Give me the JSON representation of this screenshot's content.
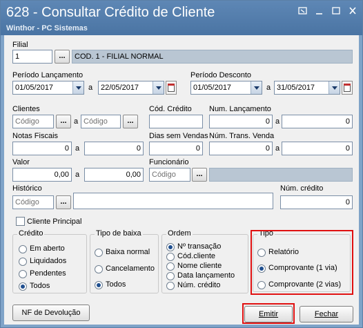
{
  "window": {
    "title": "628 - Consultar Crédito de Cliente",
    "subtitle": "Winthor - PC Sistemas",
    "controls": [
      "restore",
      "minimize",
      "maximize",
      "close"
    ]
  },
  "filial": {
    "label": "Filial",
    "code": "1",
    "description": "COD. 1 - FILIAL NORMAL"
  },
  "periodo_lancamento": {
    "label": "Período Lançamento",
    "start": "01/05/2017",
    "sep": "a",
    "end": "22/05/2017"
  },
  "periodo_desconto": {
    "label": "Período Desconto",
    "start": "01/05/2017",
    "sep": "a",
    "end": "31/05/2017"
  },
  "clientes": {
    "label": "Clientes",
    "from_placeholder": "Código",
    "sep": "a",
    "to_placeholder": "Código"
  },
  "cod_credito": {
    "label": "Cód. Crédito",
    "value": ""
  },
  "num_lancamento": {
    "label": "Num. Lançamento",
    "from": "0",
    "sep": "a",
    "to": "0"
  },
  "notas_fiscais": {
    "label": "Notas Fiscais",
    "from": "0",
    "sep": "a",
    "to": "0"
  },
  "dias_sem_vendas": {
    "label": "Dias sem Vendas",
    "value": "0"
  },
  "num_trans_venda": {
    "label": "Núm. Trans. Venda",
    "from": "0",
    "sep": "a",
    "to": "0"
  },
  "valor": {
    "label": "Valor",
    "from": "0,00",
    "sep": "a",
    "to": "0,00"
  },
  "funcionario": {
    "label": "Funcionário",
    "placeholder": "Código"
  },
  "historico": {
    "label": "Histórico",
    "placeholder": "Código"
  },
  "num_credito": {
    "label": "Núm. crédito",
    "value": "0"
  },
  "cliente_principal": {
    "label": "Cliente Principal",
    "checked": false
  },
  "credito": {
    "title": "Crédito",
    "options": [
      "Em aberto",
      "Liquidados",
      "Pendentes",
      "Todos"
    ],
    "selected": "Todos"
  },
  "tipo_baixa": {
    "title": "Tipo de baixa",
    "options": [
      "Baixa normal",
      "Cancelamento",
      "Todos"
    ],
    "selected": "Todos"
  },
  "ordem": {
    "title": "Ordem",
    "options": [
      "Nº transação",
      "Cód.cliente",
      "Nome cliente",
      "Data lançamento",
      "Núm. crédito"
    ],
    "selected": "Nº transação"
  },
  "tipo": {
    "title": "Tipo",
    "options": [
      "Relatório",
      "Comprovante (1 via)",
      "Comprovante (2 vias)"
    ],
    "selected": "Comprovante (1 via)"
  },
  "buttons": {
    "nf_devolucao": "NF de Devolução",
    "emitir": "Emitir",
    "fechar": "Fechar"
  },
  "colors": {
    "title_bar": "#4a74a3",
    "window_bg": "#f0f0f0",
    "highlight": "#e01010"
  }
}
